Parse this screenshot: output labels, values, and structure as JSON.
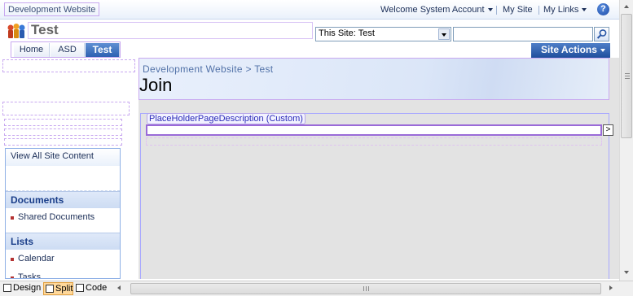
{
  "global": {
    "site_link": "Development Website",
    "welcome": "Welcome System Account",
    "my_site": "My Site",
    "my_links": "My Links",
    "help": "?"
  },
  "header": {
    "site_title": "Test",
    "search_scope": "This Site: Test",
    "search_value": ""
  },
  "nav": {
    "tabs": [
      {
        "label": "Home"
      },
      {
        "label": "ASD"
      },
      {
        "label": "Test",
        "active": true
      }
    ],
    "site_actions": "Site Actions"
  },
  "main": {
    "breadcrumb": "Development Website > Test",
    "page_title": "Join",
    "placeholder_label": "PlaceHolderPageDescription (Custom)",
    "placeholder_value": ""
  },
  "quicklaunch": {
    "view_all": "View All Site Content",
    "sections": [
      {
        "heading": "Documents",
        "items": [
          "Shared Documents"
        ]
      },
      {
        "heading": "Lists",
        "items": [
          "Calendar",
          "Tasks"
        ]
      }
    ]
  },
  "viewbar": {
    "design": "Design",
    "split": "Split",
    "code": "Code",
    "active": "Split"
  },
  "colors": {
    "accent": "#2e61b2",
    "site_actions_bg": "#1f4e9c",
    "bullet": "#b43232",
    "edit_outline": "#c8a8f0"
  },
  "icons": [
    "sharepoint-logo-icon",
    "chevron-down-icon",
    "help-icon",
    "search-icon",
    "chevron-right-icon",
    "scroll-up-icon",
    "scroll-down-icon",
    "scroll-left-icon",
    "scroll-right-icon"
  ]
}
